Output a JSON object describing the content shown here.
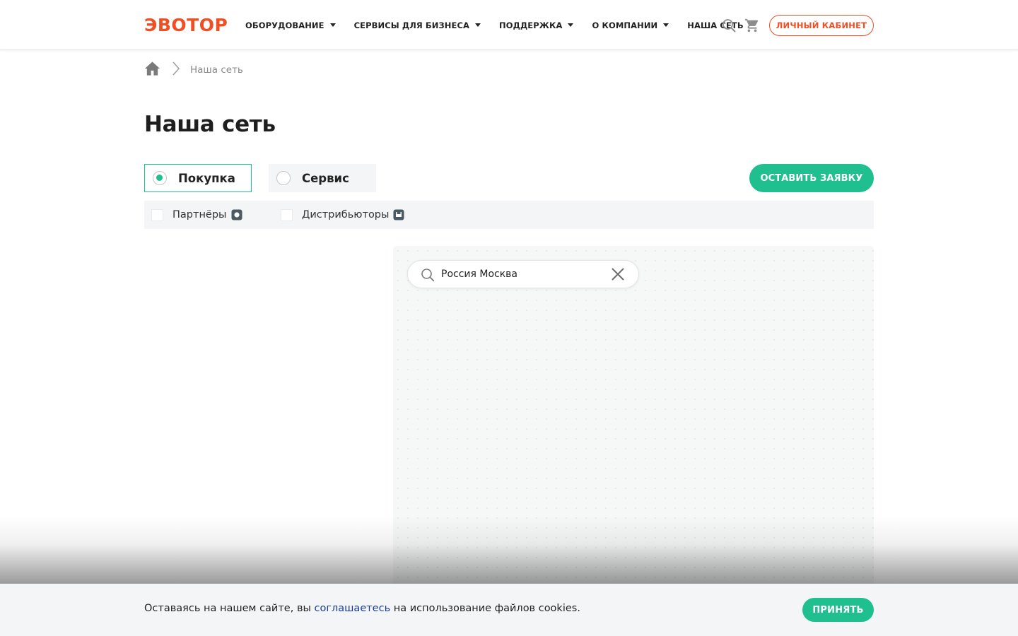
{
  "header": {
    "logo": "ЭВОТОР",
    "nav": [
      {
        "label": "ОБОРУДОВАНИЕ",
        "dropdown": true
      },
      {
        "label": "СЕРВИСЫ ДЛЯ БИЗНЕСА",
        "dropdown": true
      },
      {
        "label": "ПОДДЕРЖКА",
        "dropdown": true
      },
      {
        "label": "О КОМПАНИИ",
        "dropdown": true
      },
      {
        "label": "НАША СЕТЬ",
        "dropdown": false
      }
    ],
    "cabinet_label": "ЛИЧНЫЙ КАБИНЕТ",
    "icons": [
      "search-icon",
      "cart-icon"
    ]
  },
  "breadcrumb": {
    "home_icon": "home-icon",
    "current": "Наша сеть"
  },
  "page": {
    "title": "Наша сеть"
  },
  "tabs": {
    "buy_label": "Покупка",
    "service_label": "Сервис",
    "selected": "Покупка"
  },
  "cta": {
    "label": "ОСТАВИТЬ ЗАЯВКУ"
  },
  "filters": {
    "partners_label": "Партнёры",
    "distributors_label": "Дистрибьюторы"
  },
  "map": {
    "search_value": "Россия Москва"
  },
  "cookie": {
    "text_before": "Оставаясь на нашем сайте, вы ",
    "link_text": "соглашаетесь",
    "text_after": " на использование файлов cookies.",
    "accept_label": "ПРИНЯТЬ"
  },
  "colors": {
    "brand": "#f04e23",
    "accent": "#1fbf8f",
    "pin_dark": "#4a5a63",
    "link": "#1a3aa0"
  }
}
